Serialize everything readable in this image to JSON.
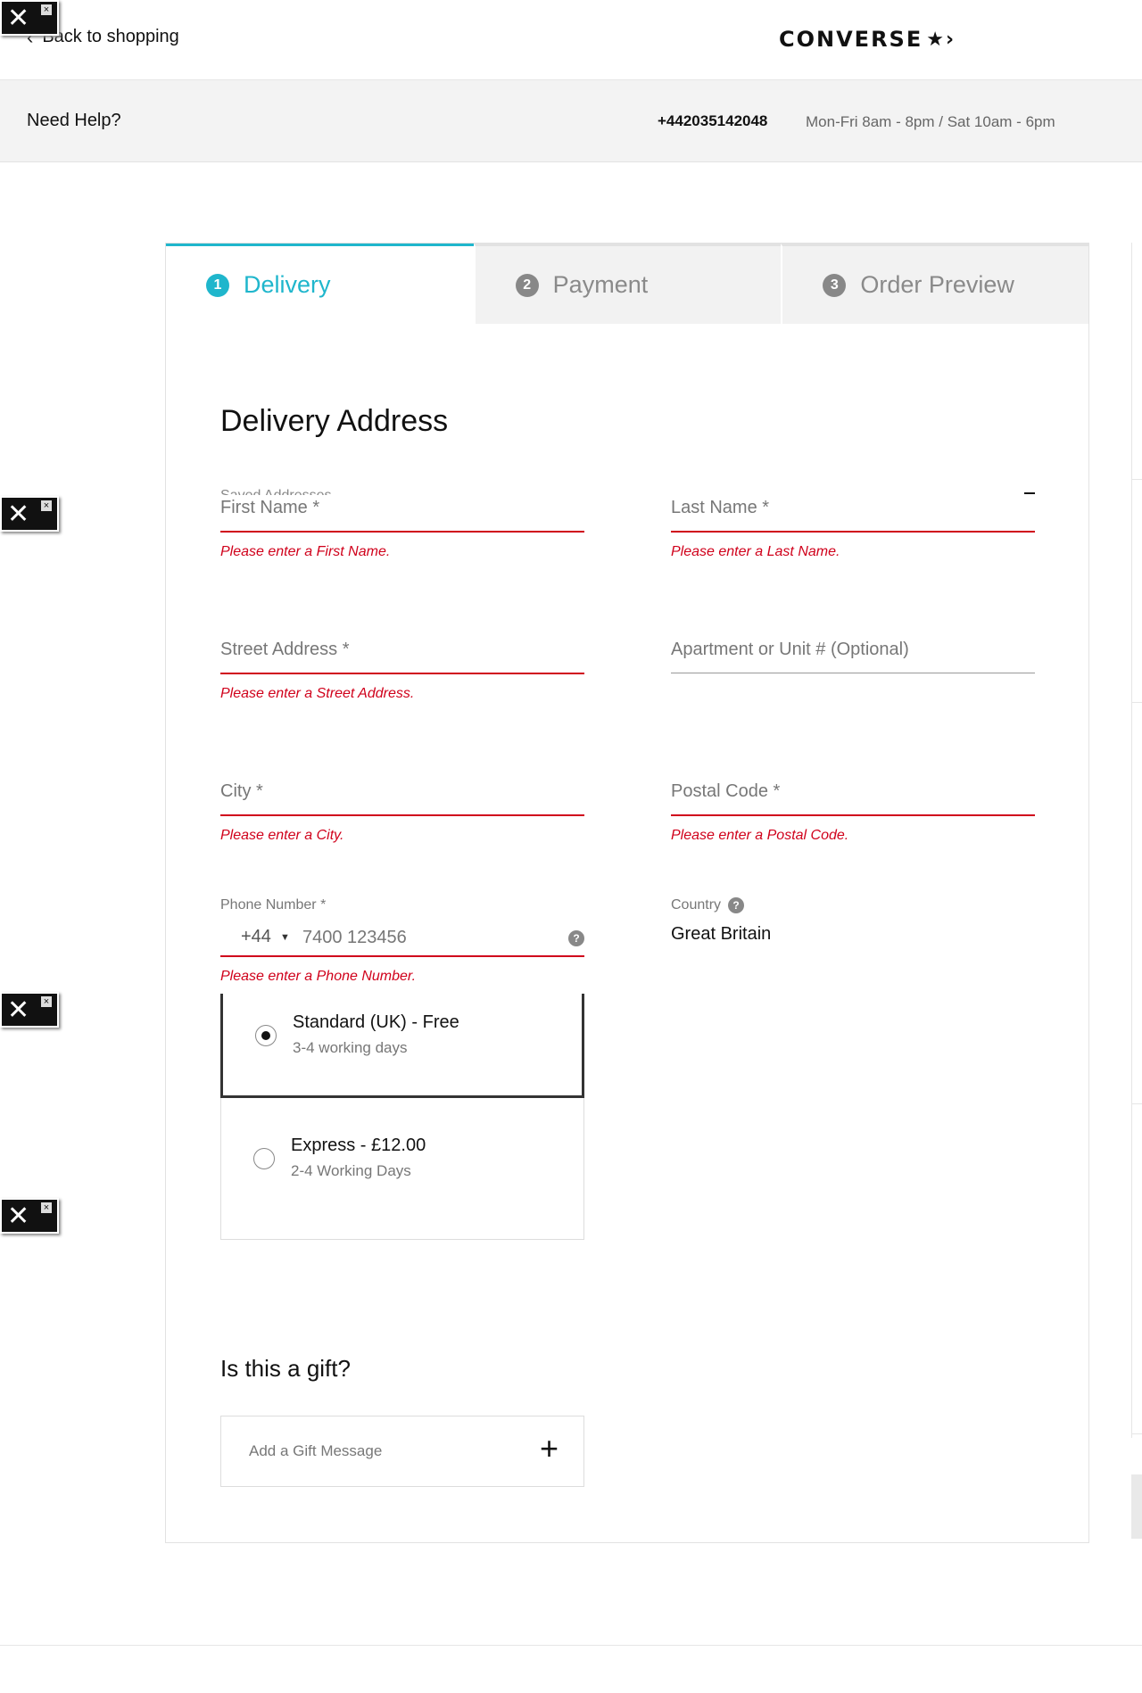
{
  "header": {
    "back_label": "Back to shopping",
    "brand": "CONVERSE"
  },
  "help": {
    "title": "Need Help?",
    "phone": "+442035142048",
    "hours": "Mon-Fri 8am - 8pm / Sat 10am - 6pm"
  },
  "steps": [
    {
      "number": "1",
      "label": "Delivery",
      "active": true
    },
    {
      "number": "2",
      "label": "Payment",
      "active": false
    },
    {
      "number": "3",
      "label": "Order Preview",
      "active": false
    }
  ],
  "delivery": {
    "title": "Delivery Address",
    "saved_addresses_label": "Saved Addresses",
    "first_name": {
      "label": "First Name *",
      "error": "Please enter a First Name."
    },
    "last_name": {
      "label": "Last Name *",
      "error": "Please enter a Last Name."
    },
    "street": {
      "label": "Street Address *",
      "error": "Please enter a Street Address."
    },
    "apartment": {
      "label": "Apartment or Unit # (Optional)"
    },
    "city": {
      "label": "City *",
      "error": "Please enter a City."
    },
    "postal": {
      "label": "Postal Code *",
      "error": "Please enter a Postal Code."
    },
    "phone": {
      "label": "Phone Number *",
      "code": "+44",
      "placeholder": "7400 123456",
      "error": "Please enter a Phone Number."
    },
    "country": {
      "label": "Country",
      "value": "Great Britain"
    }
  },
  "shipping": [
    {
      "title": "Standard (UK) - Free",
      "subtitle": "3-4 working days",
      "selected": true
    },
    {
      "title": "Express - £12.00",
      "subtitle": "2-4 Working Days",
      "selected": false
    }
  ],
  "gift": {
    "title": "Is this a gift?",
    "add_label": "Add a Gift Message",
    "plus": "+"
  },
  "colors": {
    "accent": "#1fb6cc",
    "error": "#d0011b"
  },
  "icons": {
    "tool": "tools-icon",
    "close": "close-icon",
    "help": "question-icon"
  }
}
